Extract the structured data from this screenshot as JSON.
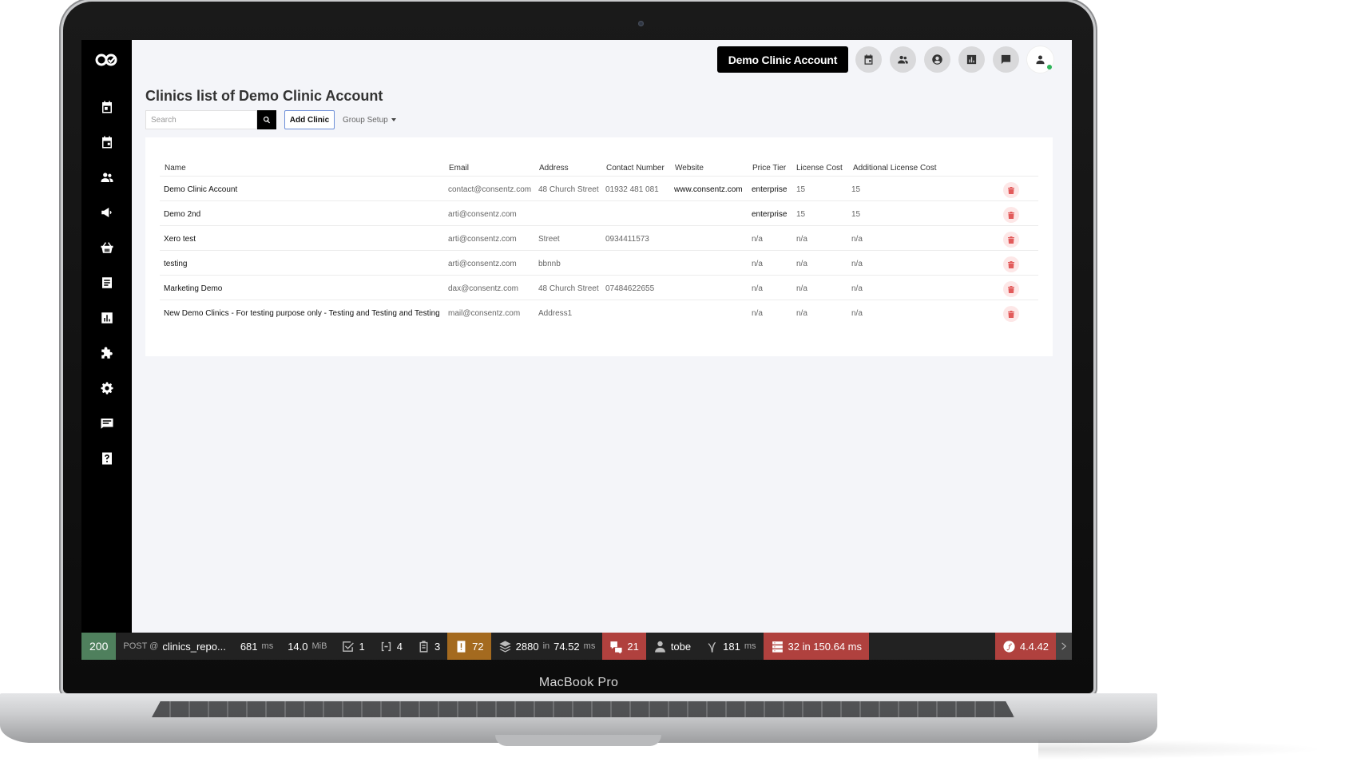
{
  "device": {
    "brand_label": "MacBook Pro"
  },
  "header": {
    "account_name": "Demo Clinic Account",
    "icons": [
      "calendar-icon",
      "users-icon",
      "user-circle-icon",
      "report-icon",
      "chat-icon",
      "avatar-icon"
    ]
  },
  "sidebar": {
    "icons": [
      "calendar-icon",
      "calendar-event-icon",
      "people-icon",
      "megaphone-icon",
      "basket-icon",
      "document-icon",
      "chart-icon",
      "puzzle-icon",
      "gear-icon",
      "message-icon",
      "help-icon"
    ]
  },
  "page": {
    "title": "Clinics list of Demo Clinic Account",
    "search_placeholder": "Search",
    "add_clinic_label": "Add Clinic",
    "group_setup_label": "Group Setup"
  },
  "table": {
    "columns": [
      "Name",
      "Email",
      "Address",
      "Contact Number",
      "Website",
      "Price Tier",
      "License Cost",
      "Additional License Cost"
    ],
    "rows": [
      {
        "name": "Demo Clinic Account",
        "email": "contact@consentz.com",
        "address": "48 Church Street",
        "contact": "01932 481 081",
        "website": "www.consentz.com",
        "tier": "enterprise",
        "license": "15",
        "additional": "15"
      },
      {
        "name": "Demo 2nd",
        "email": "arti@consentz.com",
        "address": "",
        "contact": "",
        "website": "",
        "tier": "enterprise",
        "license": "15",
        "additional": "15"
      },
      {
        "name": "Xero test",
        "email": "arti@consentz.com",
        "address": "Street",
        "contact": "0934411573",
        "website": "",
        "tier": "n/a",
        "license": "n/a",
        "additional": "n/a"
      },
      {
        "name": "testing",
        "email": "arti@consentz.com",
        "address": "bbnnb",
        "contact": "",
        "website": "",
        "tier": "n/a",
        "license": "n/a",
        "additional": "n/a"
      },
      {
        "name": "Marketing Demo",
        "email": "dax@consentz.com",
        "address": "48 Church Street",
        "contact": "07484622655",
        "website": "",
        "tier": "n/a",
        "license": "n/a",
        "additional": "n/a"
      },
      {
        "name": "New Demo Clinics - For testing purpose only - Testing and Testing and Testing",
        "email": "mail@consentz.com",
        "address": "Address1",
        "contact": "",
        "website": "",
        "tier": "n/a",
        "license": "n/a",
        "additional": "n/a"
      }
    ]
  },
  "devbar": {
    "status": "200",
    "method": "POST @",
    "route": "clinics_repo...",
    "time": "681",
    "time_unit": "ms",
    "memory": "14.0",
    "memory_unit": "MiB",
    "validations": "1",
    "forms": "4",
    "logs": "3",
    "warnings": "72",
    "cache": "2880",
    "cache_in": "in",
    "cache_time": "74.52",
    "cache_unit": "ms",
    "translations": "21",
    "user": "tobe",
    "render_time": "181",
    "render_unit": "ms",
    "db": "32 in 150.64 ms",
    "version": "4.4.42",
    "colors": {
      "status": "#4f805d",
      "warning": "#a46a1f",
      "error": "#b0413e"
    }
  }
}
